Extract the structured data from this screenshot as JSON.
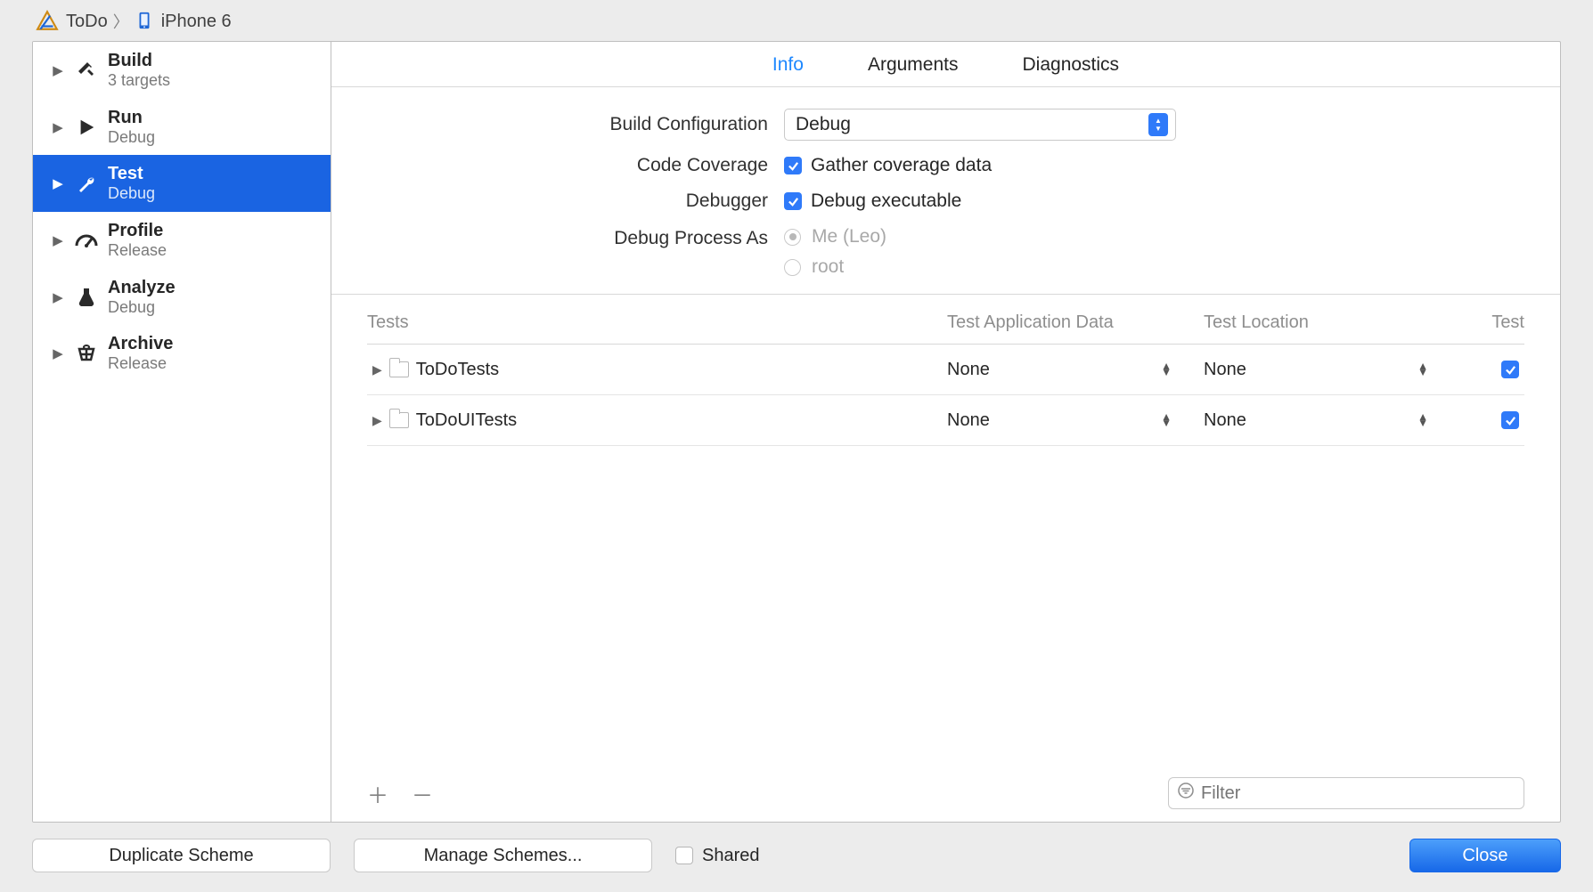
{
  "header": {
    "scheme": "ToDo",
    "destination": "iPhone 6"
  },
  "sidebar": {
    "items": [
      {
        "title": "Build",
        "subtitle": "3 targets"
      },
      {
        "title": "Run",
        "subtitle": "Debug"
      },
      {
        "title": "Test",
        "subtitle": "Debug"
      },
      {
        "title": "Profile",
        "subtitle": "Release"
      },
      {
        "title": "Analyze",
        "subtitle": "Debug"
      },
      {
        "title": "Archive",
        "subtitle": "Release"
      }
    ]
  },
  "tabs": {
    "info": "Info",
    "arguments": "Arguments",
    "diagnostics": "Diagnostics"
  },
  "form": {
    "build_configuration_label": "Build Configuration",
    "build_configuration_value": "Debug",
    "code_coverage_label": "Code Coverage",
    "code_coverage_text": "Gather coverage data",
    "debugger_label": "Debugger",
    "debugger_text": "Debug executable",
    "debug_as_label": "Debug Process As",
    "debug_as_me": "Me (Leo)",
    "debug_as_root": "root"
  },
  "tests": {
    "cols": {
      "tests": "Tests",
      "data": "Test Application Data",
      "location": "Test Location",
      "test": "Test"
    },
    "rows": [
      {
        "name": "ToDoTests",
        "data": "None",
        "location": "None"
      },
      {
        "name": "ToDoUITests",
        "data": "None",
        "location": "None"
      }
    ],
    "filter_placeholder": "Filter"
  },
  "buttons": {
    "duplicate": "Duplicate Scheme",
    "manage": "Manage Schemes...",
    "shared": "Shared",
    "close": "Close"
  }
}
